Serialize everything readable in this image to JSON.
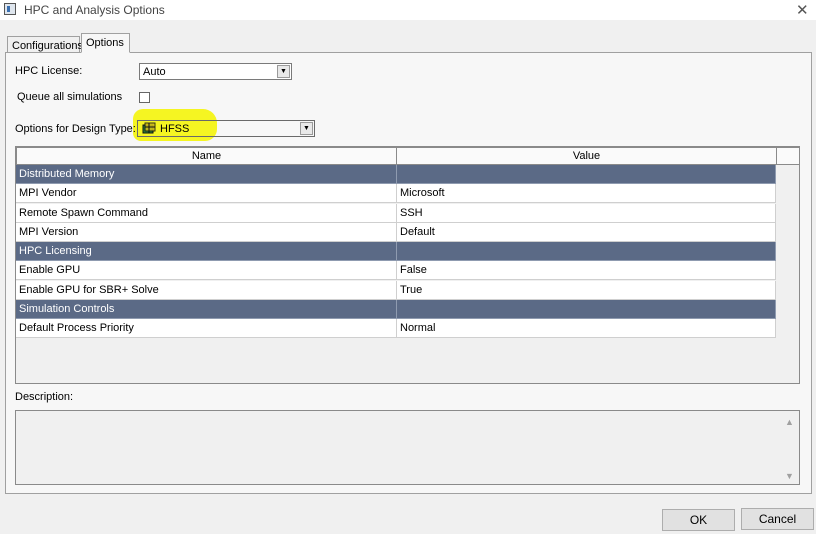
{
  "window": {
    "title": "HPC and Analysis Options"
  },
  "tabs": [
    {
      "label": "Configurations",
      "active": false
    },
    {
      "label": "Options",
      "active": true
    }
  ],
  "hpc_license": {
    "label": "HPC License:",
    "value": "Auto"
  },
  "queue_all": {
    "label": "Queue all simulations",
    "checked": false
  },
  "design_type": {
    "label": "Options for Design Type:",
    "value": "HFSS",
    "icon": "hfss-icon"
  },
  "grid": {
    "columns": [
      "Name",
      "Value"
    ],
    "rows": [
      {
        "name": "Distributed Memory",
        "value": "",
        "section": true
      },
      {
        "name": "MPI Vendor",
        "value": "Microsoft",
        "section": false
      },
      {
        "name": "Remote Spawn Command",
        "value": "SSH",
        "section": false
      },
      {
        "name": "MPI Version",
        "value": "Default",
        "section": false
      },
      {
        "name": "HPC Licensing",
        "value": "",
        "section": true
      },
      {
        "name": "Enable GPU",
        "value": "False",
        "section": false
      },
      {
        "name": "Enable GPU for SBR+ Solve",
        "value": "True",
        "section": false
      },
      {
        "name": "Simulation Controls",
        "value": "",
        "section": true
      },
      {
        "name": "Default Process Priority",
        "value": "Normal",
        "section": false
      }
    ]
  },
  "description": {
    "label": "Description:",
    "text": ""
  },
  "buttons": {
    "ok": "OK",
    "cancel": "Cancel"
  },
  "colors": {
    "section_bg": "#5b6a86",
    "highlight": "#f4f40a"
  }
}
